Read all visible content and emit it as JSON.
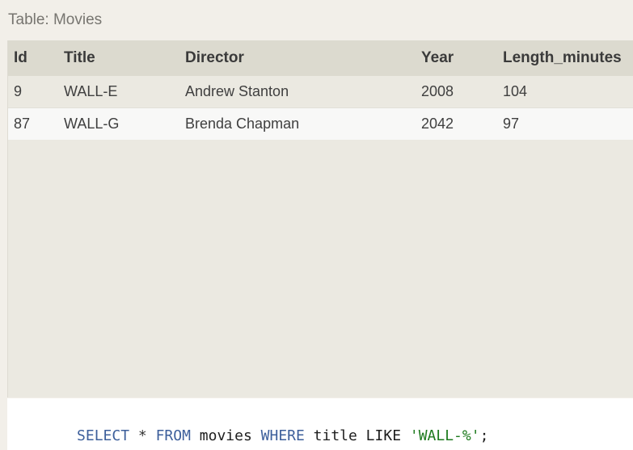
{
  "caption": "Table: Movies",
  "table": {
    "columns": [
      "Id",
      "Title",
      "Director",
      "Year",
      "Length_minutes"
    ],
    "rows": [
      [
        "9",
        "WALL-E",
        "Andrew Stanton",
        "2008",
        "104"
      ],
      [
        "87",
        "WALL-G",
        "Brenda Chapman",
        "2042",
        "97"
      ]
    ]
  },
  "query": {
    "tokens": [
      {
        "text": "SELECT",
        "kind": "keyword"
      },
      {
        "text": " * ",
        "kind": "operator"
      },
      {
        "text": "FROM",
        "kind": "keyword"
      },
      {
        "text": " movies ",
        "kind": "plain"
      },
      {
        "text": "WHERE",
        "kind": "keyword"
      },
      {
        "text": " title LIKE ",
        "kind": "plain"
      },
      {
        "text": "'WALL-%'",
        "kind": "string"
      },
      {
        "text": ";",
        "kind": "plain"
      }
    ]
  },
  "colors": {
    "keyword": "#3d5f9b",
    "string": "#1d7a1d",
    "header_bg": "#dcdacf",
    "panel_bg": "#ebe9e1"
  }
}
